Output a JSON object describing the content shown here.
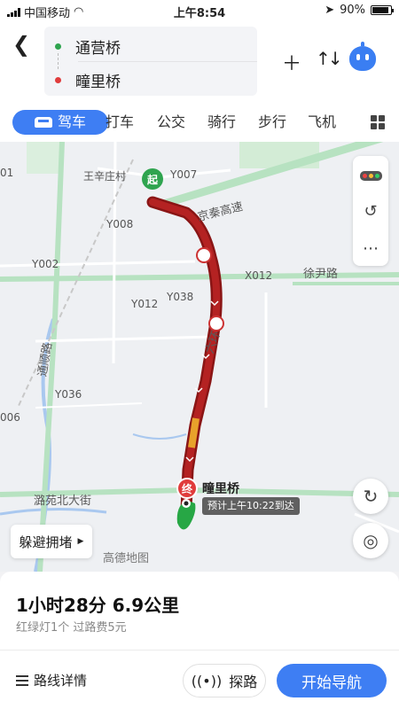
{
  "status_bar": {
    "carrier": "中国移动",
    "time": "上午8:54",
    "battery": "90%"
  },
  "route": {
    "origin": "通营桥",
    "destination": "疃里桥"
  },
  "tabs": [
    "驾车",
    "打车",
    "公交",
    "骑行",
    "步行",
    "飞机"
  ],
  "map": {
    "start_pin": "起",
    "end_pin": "终",
    "end_label": "疃里桥",
    "eta": "预计上午10:22到达",
    "logo": "高德地图",
    "avoid_congestion": "躲避拥堵",
    "labels": {
      "village": "王辛庄村",
      "y007": "Y007",
      "jingqin": "京秦高速",
      "y008": "Y008",
      "y002": "Y002",
      "x012": "X012",
      "xuyin": "徐尹路",
      "y038": "Y038",
      "y012": "Y012",
      "liuhuan": "六环",
      "tongshun": "通顺路",
      "y036": "Y036",
      "luoyuan": "潞苑北大街",
      "edge_01": "01",
      "edge_006": "006"
    }
  },
  "summary": {
    "duration_distance": "1小时28分  6.9公里",
    "details": "红绿灯1个  过路费5元"
  },
  "actions": {
    "route_detail": "路线详情",
    "explore": "探路",
    "start_navigation": "开始导航"
  },
  "colors": {
    "accent": "#3e7ef3",
    "route": "#a51f1f",
    "origin": "#2fa44f",
    "destination": "#e03c3c"
  }
}
